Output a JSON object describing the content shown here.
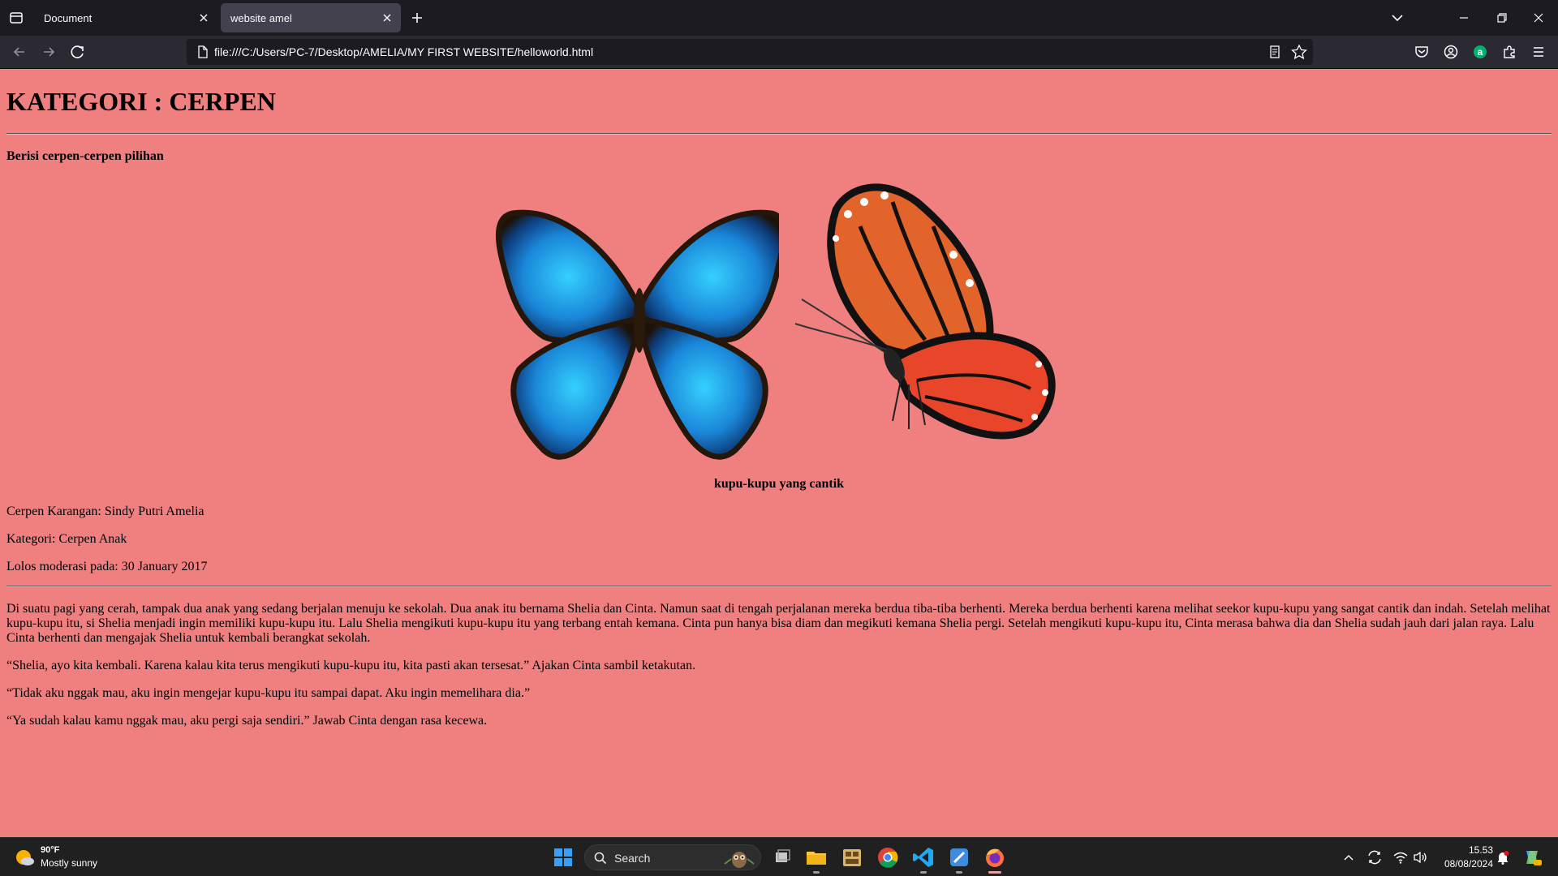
{
  "browser": {
    "tabs": [
      {
        "title": "Document",
        "active": false
      },
      {
        "title": "website amel",
        "active": true
      }
    ],
    "url": "file:///C:/Users/PC-7/Desktop/AMELIA/MY FIRST WEBSITE/helloworld.html"
  },
  "page": {
    "heading": "KATEGORI : CERPEN",
    "subtitle": "Berisi cerpen-cerpen pilihan",
    "images": [
      {
        "icon": "blue-morpho-butterfly-image"
      },
      {
        "icon": "monarch-butterfly-image"
      }
    ],
    "caption": "kupu-kupu yang cantik",
    "author": "Cerpen Karangan: Sindy Putri Amelia",
    "category": "Kategori: Cerpen Anak",
    "moderation": "Lolos moderasi pada: 30 January 2017",
    "paragraphs": [
      "Di suatu pagi yang cerah, tampak dua anak yang sedang berjalan menuju ke sekolah. Dua anak itu bernama Shelia dan Cinta. Namun saat di tengah perjalanan mereka berdua tiba-tiba berhenti. Mereka berdua berhenti karena melihat seekor kupu-kupu yang sangat cantik dan indah. Setelah melihat kupu-kupu itu, si Shelia menjadi ingin memiliki kupu-kupu itu. Lalu Shelia mengikuti kupu-kupu itu yang terbang entah kemana. Cinta pun hanya bisa diam dan megikuti kemana Shelia pergi. Setelah mengikuti kupu-kupu itu, Cinta merasa bahwa dia dan Shelia sudah jauh dari jalan raya. Lalu Cinta berhenti dan mengajak Shelia untuk kembali berangkat sekolah.",
      "“Shelia, ayo kita kembali. Karena kalau kita terus mengikuti kupu-kupu itu, kita pasti akan tersesat.” Ajakan Cinta sambil ketakutan.",
      "“Tidak aku nggak mau, aku ingin mengejar kupu-kupu itu sampai dapat. Aku ingin memelihara dia.”",
      "“Ya sudah kalau kamu nggak mau, aku pergi saja sendiri.” Jawab Cinta dengan rasa kecewa."
    ]
  },
  "taskbar": {
    "weather_temp": "90°F",
    "weather_desc": "Mostly sunny",
    "search_label": "Search",
    "time": "15.53",
    "date": "08/08/2024"
  },
  "colors": {
    "page_background": "#f08080",
    "chrome_dark": "#1c1b22",
    "toolbar": "#2b2a33",
    "taskbar": "#202020"
  }
}
